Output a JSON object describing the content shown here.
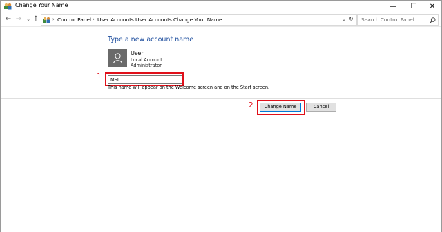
{
  "window": {
    "title": "Change Your Name",
    "controls": {
      "minimize": "—",
      "maximize": "☐",
      "close": "✕"
    }
  },
  "address_bar": {
    "nav": {
      "back": "←",
      "forward": "→",
      "recent": "⌄",
      "up": "↑"
    },
    "breadcrumbs": [
      "Control Panel",
      "User Accounts",
      "User Accounts",
      "Change Your Name"
    ],
    "separator": "›",
    "dropdown": "⌄",
    "refresh": "↻",
    "search_placeholder": "Search Control Panel"
  },
  "main": {
    "heading": "Type a new account name",
    "user": {
      "name": "User",
      "account_type": "Local Account",
      "role": "Administrator"
    },
    "name_input_value": "MSI",
    "note": "This name will appear on the Welcome screen and on the Start screen.",
    "buttons": {
      "change_name": "Change Name",
      "cancel": "Cancel"
    }
  },
  "annotations": {
    "step1": "1",
    "step2": "2"
  },
  "colors": {
    "heading": "#1e4e9e",
    "highlight": "#e0101a",
    "avatar_bg": "#6a6a6a",
    "primary_button_border": "#0078d7"
  },
  "icons": [
    "user-accounts-icon",
    "back-arrow-icon",
    "forward-arrow-icon",
    "recent-chevron-icon",
    "up-arrow-icon",
    "dropdown-chevron-icon",
    "refresh-icon",
    "search-icon",
    "user-avatar-icon"
  ]
}
